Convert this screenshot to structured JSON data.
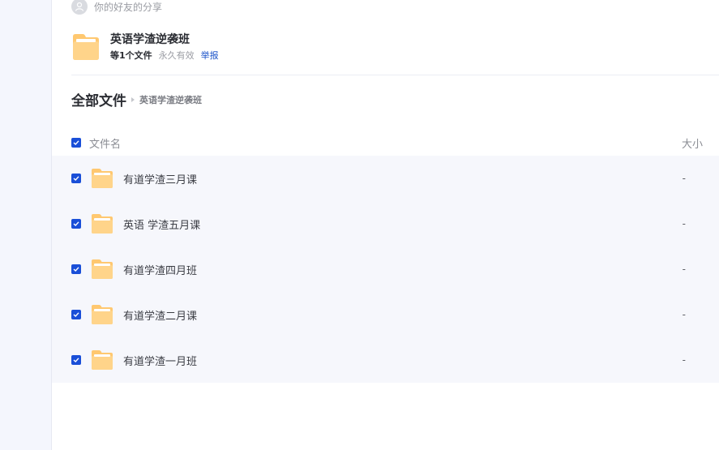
{
  "share": {
    "sharer_text": "你的好友的分享",
    "title": "英语学渣逆袭班",
    "file_count": "等1个文件",
    "validity": "永久有效",
    "report_label": "举报"
  },
  "breadcrumb": {
    "root": "全部文件",
    "current": "英语学渣逆袭班"
  },
  "list": {
    "header_name": "文件名",
    "header_size": "大小",
    "rows": [
      {
        "name": "有道学渣三月课",
        "size": "-"
      },
      {
        "name": "英语 学渣五月课",
        "size": "-"
      },
      {
        "name": "有道学渣四月班",
        "size": "-"
      },
      {
        "name": "有道学渣二月课",
        "size": "-"
      },
      {
        "name": "有道学渣一月班",
        "size": "-"
      }
    ]
  },
  "icons": {
    "avatar": "user-avatar-icon",
    "folder": "folder-icon",
    "checkbox": "checked-checkbox-icon"
  },
  "colors": {
    "accent": "#1a4fd8",
    "folder": "#ffc870",
    "link": "#1a53c9",
    "row_bg": "#f6f7fc"
  }
}
